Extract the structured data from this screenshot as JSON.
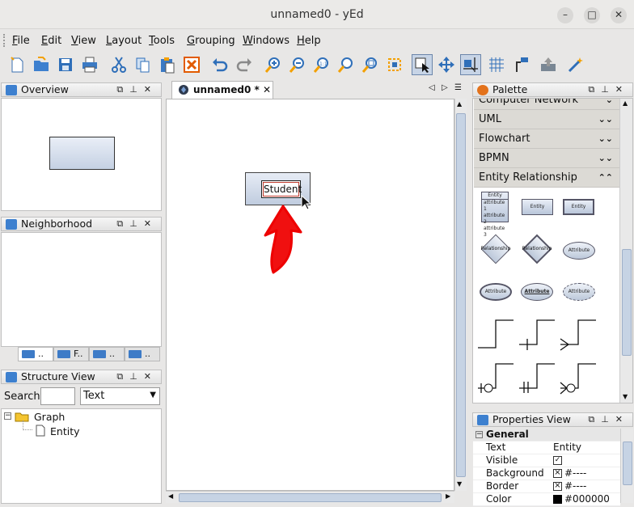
{
  "window": {
    "title": "unnamed0 - yEd"
  },
  "menus": [
    {
      "label": "File",
      "key": "F",
      "rest": "ile"
    },
    {
      "label": "Edit",
      "key": "E",
      "rest": "dit"
    },
    {
      "label": "View",
      "key": "V",
      "rest": "iew"
    },
    {
      "label": "Layout",
      "key": "L",
      "rest": "ayout"
    },
    {
      "label": "Tools",
      "key": "T",
      "rest": "ools"
    },
    {
      "label": "Grouping",
      "key": "G",
      "rest": "rouping"
    },
    {
      "label": "Windows",
      "key": "W",
      "rest": "indows"
    },
    {
      "label": "Help",
      "key": "H",
      "rest": "elp"
    }
  ],
  "toolbar": [
    "new-document-icon",
    "open-folder-icon",
    "save-icon",
    "print-icon",
    "cut-icon",
    "copy-icon",
    "paste-icon",
    "delete-icon",
    "undo-icon",
    "redo-icon",
    "zoom-in-icon",
    "zoom-out-icon",
    "zoom-original-icon",
    "zoom-fit-icon",
    "zoom-area-icon",
    "fit-content-icon",
    "edit-mode-icon",
    "move-mode-icon",
    "snap-lines-icon",
    "grid-icon",
    "orthogonal-edges-icon",
    "export-icon",
    "magic-wand-icon"
  ],
  "overview": {
    "title": "Overview"
  },
  "neighborhood": {
    "title": "Neighborhood",
    "tabs": [
      "..",
      "F..",
      "..",
      ".."
    ]
  },
  "structure": {
    "title": "Structure View",
    "search_label": "Search",
    "search_value": "",
    "search_type": "Text",
    "tree": {
      "root": "Graph",
      "child": "Entity"
    }
  },
  "document": {
    "tab": "unnamed0 *",
    "node_label": "Student"
  },
  "palette": {
    "title": "Palette",
    "sections": [
      "Computer Network",
      "UML",
      "Flowchart",
      "BPMN",
      "Entity Relationship"
    ],
    "items": {
      "entity_header": "Entity",
      "entity_attrs": [
        "attribute 1",
        "attribute 2",
        "attribute 3"
      ],
      "entity": "Entity",
      "relationship": "Relationship",
      "attribute": "Attribute"
    }
  },
  "properties": {
    "title": "Properties View",
    "section": "General",
    "rows": [
      {
        "key": "Text",
        "value": "Entity"
      },
      {
        "key": "Visible",
        "value": "✓"
      },
      {
        "key": "Background",
        "value": "#----"
      },
      {
        "key": "Border",
        "value": "#----"
      },
      {
        "key": "Color",
        "value": "#000000"
      }
    ]
  }
}
